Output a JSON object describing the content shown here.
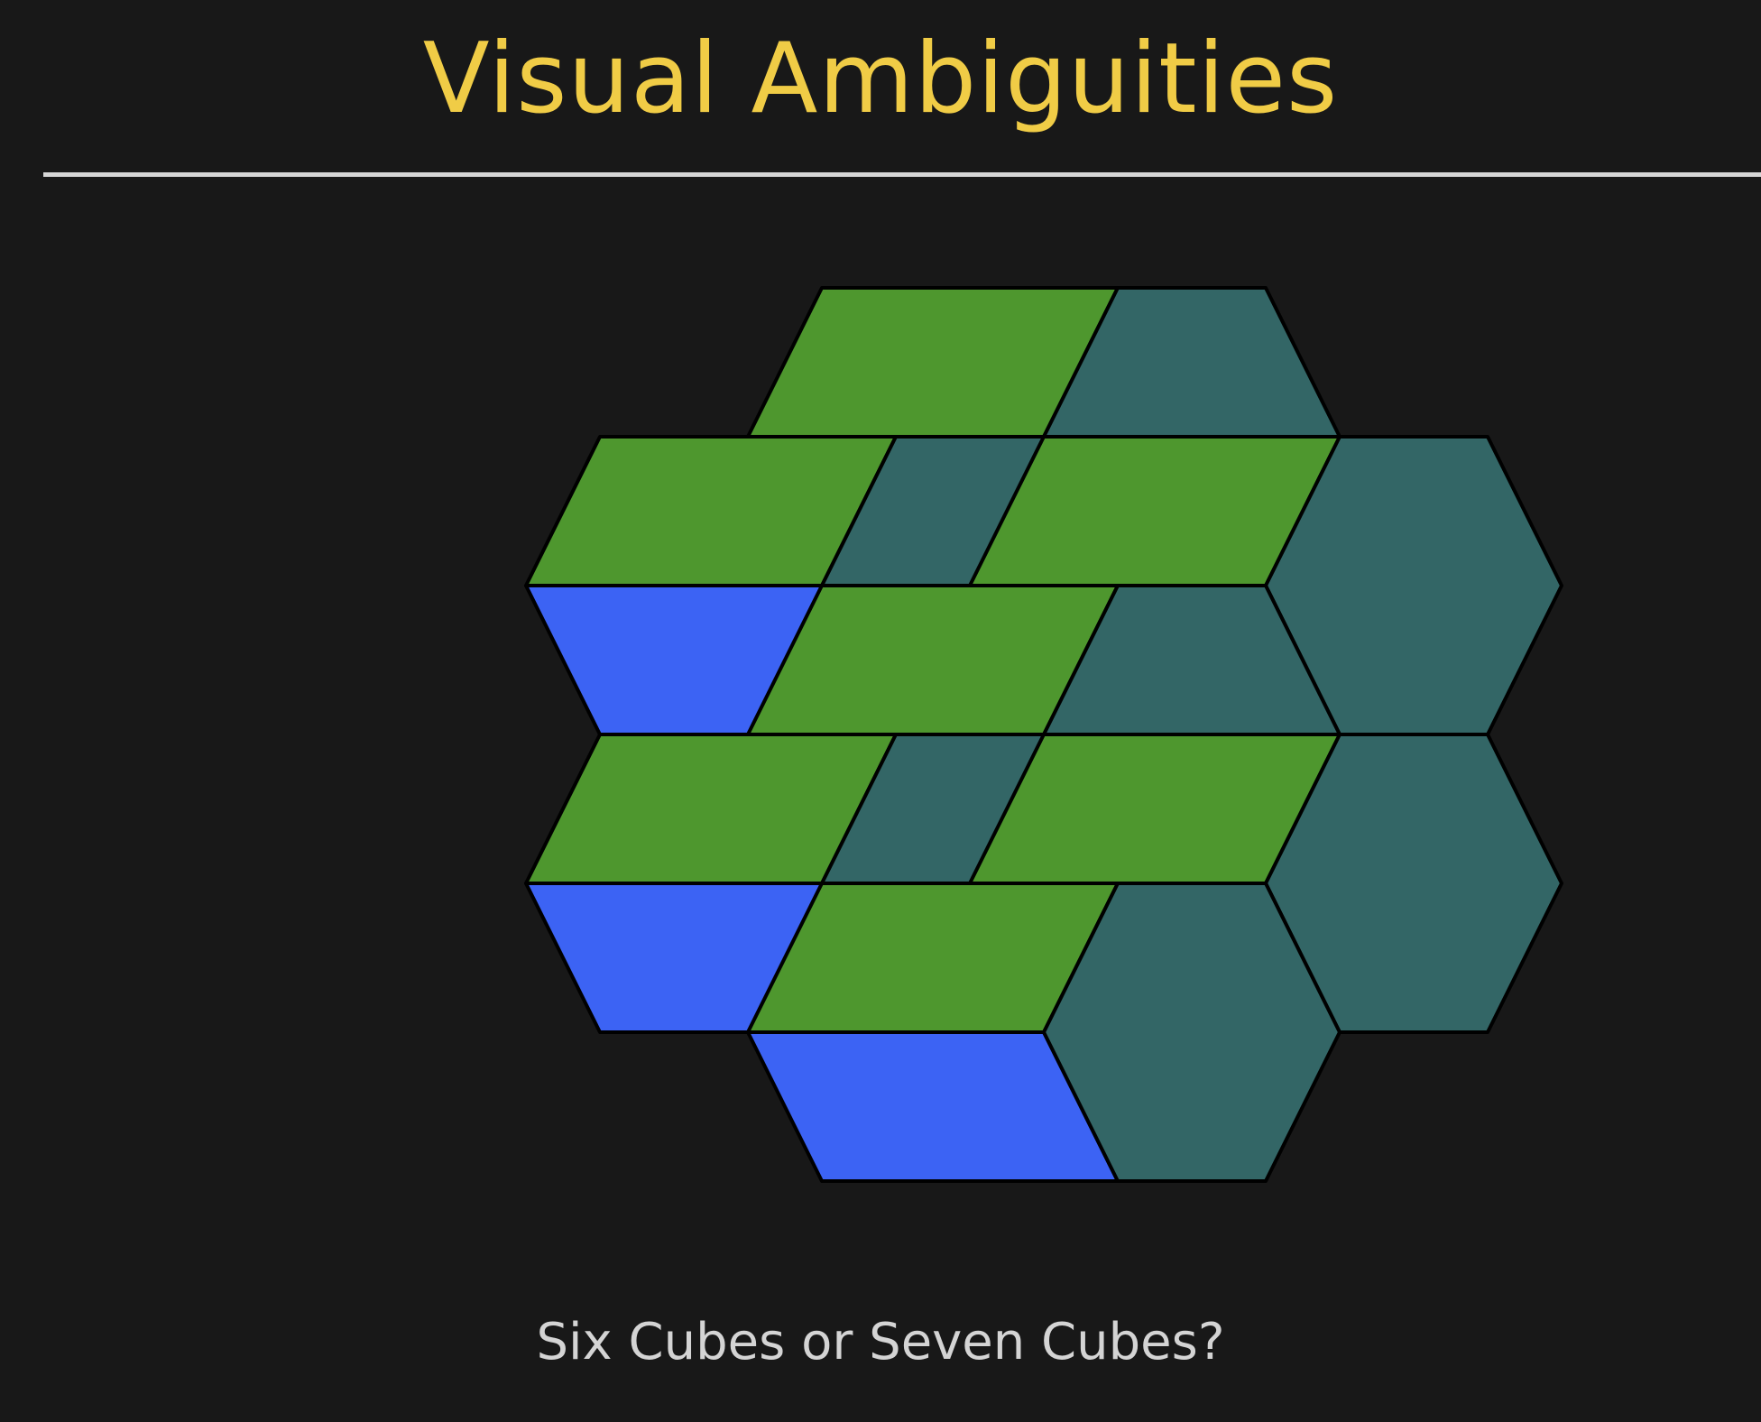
{
  "slide": {
    "title": "Visual Ambiguities",
    "caption": "Six Cubes or Seven Cubes?"
  },
  "colors": {
    "background": "#181818",
    "title": "#f0cc46",
    "caption": "#d4d4d4",
    "rule": "#d6d6d6",
    "green_face": "#4e972e",
    "blue_face": "#3c63f4",
    "teal_face": "#336666",
    "outline": "#000000"
  },
  "figure": {
    "cubes": [
      {
        "name": "top",
        "col": 0,
        "row": -2
      },
      {
        "name": "upper-left",
        "col": -1,
        "row": -1
      },
      {
        "name": "upper-right",
        "col": 1,
        "row": -1
      },
      {
        "name": "center",
        "col": 0,
        "row": 0
      },
      {
        "name": "left",
        "col": -1,
        "row": 1
      },
      {
        "name": "right",
        "col": 1,
        "row": 1
      },
      {
        "name": "lower-center",
        "col": 0,
        "row": 2
      }
    ]
  }
}
